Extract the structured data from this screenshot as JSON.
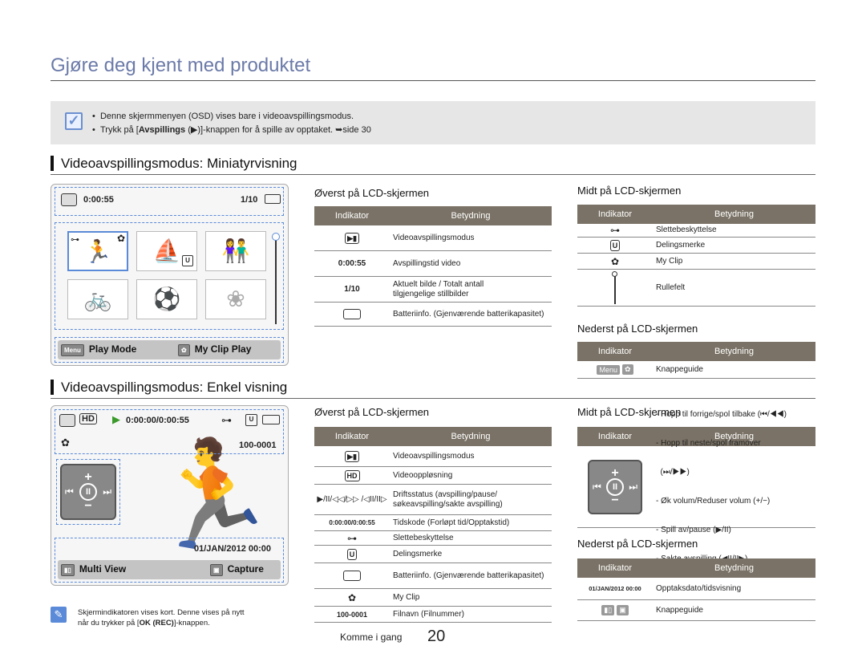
{
  "page": {
    "title": "Gjøre deg kjent med produktet",
    "footer_label": "Komme i gang",
    "page_number": "20"
  },
  "note": {
    "line1": "Denne skjermmenyen (OSD) vises bare i videoavspillingsmodus.",
    "line2_pre": "Trykk på [",
    "line2_bold": "Avspillings",
    "line2_post": " (▶)]-knappen for å spille av opptaket. ➥side 30"
  },
  "section1": {
    "heading": "Videoavspillingsmodus: Miniatyrvisning",
    "screen": {
      "time": "0:00:55",
      "counter": "1/10",
      "play_mode": "Play Mode",
      "my_clip_play": "My Clip Play",
      "menu_label": "Menu"
    },
    "top": {
      "title": "Øverst på LCD-skjermen",
      "col1": "Indikator",
      "col2": "Betydning",
      "rows": [
        {
          "ind": "",
          "desc": "Videoavspillingsmodus"
        },
        {
          "ind": "0:00:55",
          "desc": "Avspillingstid video"
        },
        {
          "ind": "1/10",
          "desc": "Aktuelt bilde / Totalt antall tilgjengelige stillbilder"
        },
        {
          "ind": "",
          "desc": "Batteriinfo. (Gjenværende batterikapasitet)"
        }
      ]
    },
    "middle": {
      "title": "Midt på LCD-skjermen",
      "col1": "Indikator",
      "col2": "Betydning",
      "rows": [
        {
          "desc": "Slettebeskyttelse"
        },
        {
          "desc": "Delingsmerke"
        },
        {
          "desc": "My Clip"
        },
        {
          "desc": "Rullefelt"
        }
      ]
    },
    "bottom": {
      "title": "Nederst på LCD-skjermen",
      "col1": "Indikator",
      "col2": "Betydning",
      "rows": [
        {
          "desc": "Knappeguide"
        }
      ]
    }
  },
  "section2": {
    "heading": "Videoavspillingsmodus: Enkel visning",
    "screen": {
      "time": "0:00:00/0:00:55",
      "file": "100-0001",
      "date": "01/JAN/2012 00:00",
      "multi_view": "Multi View",
      "capture": "Capture"
    },
    "top": {
      "title": "Øverst på LCD-skjermen",
      "col1": "Indikator",
      "col2": "Betydning",
      "rows": [
        {
          "ind": "",
          "desc": "Videoavspillingsmodus"
        },
        {
          "ind": "",
          "desc": "Videooppløsning"
        },
        {
          "ind": "▶/II/◁◁/▷▷ /◁II/II▷",
          "desc": "Driftsstatus (avspilling/pause/ søkeavspilling/sakte avspilling)"
        },
        {
          "ind": "0:00:00/0:00:55",
          "desc": "Tidskode (Forløpt tid/Opptakstid)"
        },
        {
          "ind": "",
          "desc": "Slettebeskyttelse"
        },
        {
          "ind": "",
          "desc": "Delingsmerke"
        },
        {
          "ind": "",
          "desc": "Batteriinfo. (Gjenværende batterikapasitet)"
        },
        {
          "ind": "",
          "desc": "My Clip"
        },
        {
          "ind": "100-0001",
          "desc": "Filnavn (Filnummer)"
        }
      ]
    },
    "middle": {
      "title": "Midt på LCD-skjermen",
      "col1": "Indikator",
      "col2": "Betydning",
      "lines": [
        "- Hopp til forrige/spol tilbake (⏮/◀◀)",
        "- Hopp til neste/spol framover",
        "  (⏭/▶▶)",
        "- Øk volum/Reduser volum (+/−)",
        "- Spill av/pause (▶/II)",
        "- Sakte avspilling (◀II/II▶)"
      ]
    },
    "bottom": {
      "title": "Nederst på LCD-skjermen",
      "col1": "Indikator",
      "col2": "Betydning",
      "rows": [
        {
          "ind": "01/JAN/2012 00:00",
          "desc": "Opptaksdato/tidsvisning"
        },
        {
          "ind": "",
          "desc": "Knappeguide"
        }
      ]
    },
    "tip": {
      "line1": "Skjermindikatoren vises kort. Denne vises på nytt",
      "line2_pre": "når du trykker på [",
      "line2_bold": "OK (REC)",
      "line2_post": "]-knappen."
    }
  }
}
